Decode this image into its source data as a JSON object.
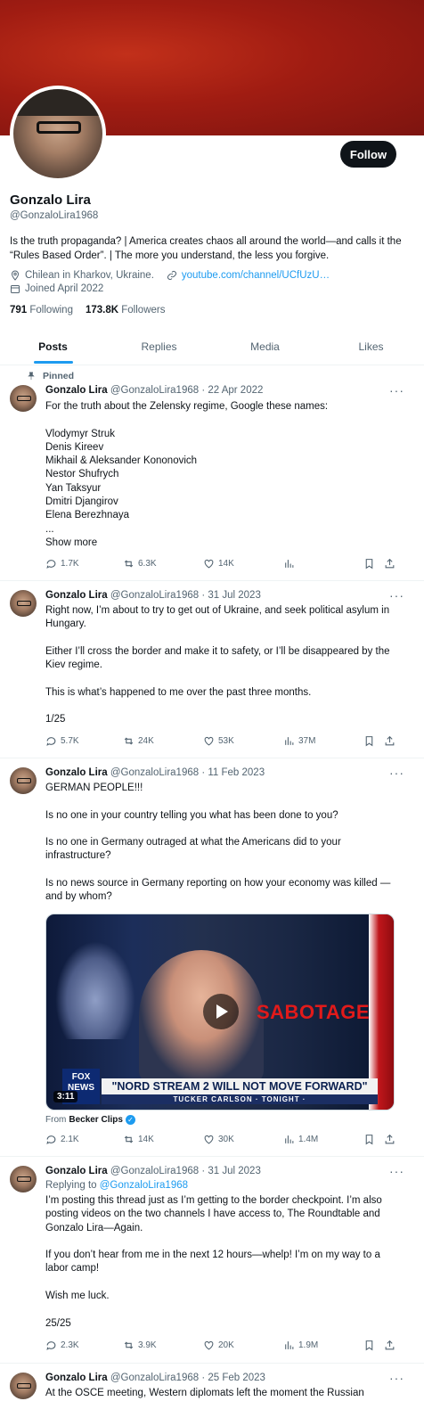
{
  "profile": {
    "name": "Gonzalo Lira",
    "handle": "@GonzaloLira1968",
    "follow_label": "Follow",
    "bio": "Is the truth propaganda? | America creates chaos all around the world—and calls it the “Rules Based Order”. | The more you understand, the less you forgive.",
    "location": "Chilean in Kharkov, Ukraine.",
    "website": "youtube.com/channel/UCfUzU…",
    "joined": "Joined April 2022",
    "following_count": "791",
    "following_label": "Following",
    "followers_count": "173.8K",
    "followers_label": "Followers"
  },
  "tabs": [
    {
      "label": "Posts"
    },
    {
      "label": "Replies"
    },
    {
      "label": "Media"
    },
    {
      "label": "Likes"
    }
  ],
  "posts": [
    {
      "pinned_label": "Pinned",
      "author": "Gonzalo Lira",
      "handle": "@GonzaloLira1968",
      "date": "· 22 Apr 2022",
      "text": "For the truth about the Zelensky regime, Google these names:\n\nVlodymyr Struk\nDenis Kireev\nMikhail & Aleksander Kononovich\nNestor Shufrych\nYan Taksyur\nDmitri Djangirov\nElena Berezhnaya\n...",
      "show_more": "Show more",
      "replies": "1.7K",
      "reposts": "6.3K",
      "likes": "14K",
      "views": ""
    },
    {
      "author": "Gonzalo Lira",
      "handle": "@GonzaloLira1968",
      "date": "· 31 Jul 2023",
      "text": "Right now, I’m about to try to get out of Ukraine, and seek political asylum in Hungary.\n\nEither I’ll cross the border and make it to safety, or I’ll be disappeared by the Kiev regime.\n\nThis is what’s happened to me over the past three months.\n\n1/25",
      "replies": "5.7K",
      "reposts": "24K",
      "likes": "53K",
      "views": "37M"
    },
    {
      "author": "Gonzalo Lira",
      "handle": "@GonzaloLira1968",
      "date": "· 11 Feb 2023",
      "text": "GERMAN PEOPLE!!!\n\nIs no one in your country telling you what has been done to you?\n\nIs no one in Germany outraged at what the Americans did to your infrastructure?\n\nIs no news source in Germany reporting on how your economy was killed — and by whom?",
      "video": {
        "sabotage": "SABOTAGE",
        "headline": "\"NORD STREAM 2 WILL NOT MOVE FORWARD\"",
        "show": "TUCKER CARLSON · TONIGHT ·",
        "network": "FOX NEWS",
        "duration": "3:11"
      },
      "from_label": "From",
      "from_source": "Becker Clips",
      "replies": "2.1K",
      "reposts": "14K",
      "likes": "30K",
      "views": "1.4M"
    },
    {
      "author": "Gonzalo Lira",
      "handle": "@GonzaloLira1968",
      "date": "· 31 Jul 2023",
      "replying_label": "Replying to",
      "replying_to": "@GonzaloLira1968",
      "text": "I’m posting this thread just as I’m getting to the border checkpoint. I’m also posting videos on the two channels I have access to, The Roundtable and Gonzalo Lira—Again.\n\nIf you don’t hear from me in the next 12 hours—whelp! I’m on my way to a labor camp!\n\nWish me luck.\n\n25/25",
      "replies": "2.3K",
      "reposts": "3.9K",
      "likes": "20K",
      "views": "1.9M"
    },
    {
      "author": "Gonzalo Lira",
      "handle": "@GonzaloLira1968",
      "date": "· 25 Feb 2023",
      "text": "At the OSCE meeting, Western diplomats left the moment the Russian"
    }
  ]
}
